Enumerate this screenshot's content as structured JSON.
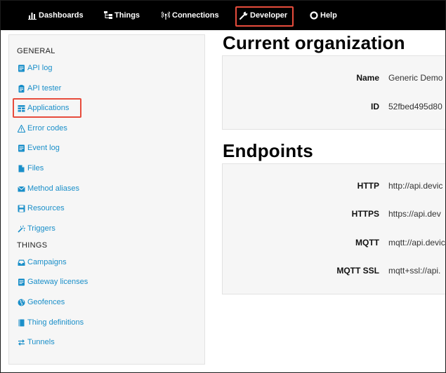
{
  "nav": {
    "items": [
      {
        "label": "Dashboards",
        "icon": "bar-chart-icon"
      },
      {
        "label": "Things",
        "icon": "hierarchy-icon"
      },
      {
        "label": "Connections",
        "icon": "broadcast-icon"
      },
      {
        "label": "Developer",
        "icon": "wrench-icon"
      },
      {
        "label": "Help",
        "icon": "lifebuoy-icon"
      }
    ],
    "highlighted": "Developer",
    "highlight_color": "#e74c3c"
  },
  "sidebar": {
    "general_heading": "GENERAL",
    "general_items": [
      {
        "label": "API log",
        "icon": "log-icon"
      },
      {
        "label": "API tester",
        "icon": "clipboard-icon"
      },
      {
        "label": "Applications",
        "icon": "applications-icon"
      },
      {
        "label": "Error codes",
        "icon": "warning-icon"
      },
      {
        "label": "Event log",
        "icon": "event-log-icon"
      },
      {
        "label": "Files",
        "icon": "file-icon"
      },
      {
        "label": "Method aliases",
        "icon": "envelope-icon"
      },
      {
        "label": "Resources",
        "icon": "save-icon"
      },
      {
        "label": "Triggers",
        "icon": "magic-wand-icon"
      }
    ],
    "things_heading": "THINGS",
    "things_items": [
      {
        "label": "Campaigns",
        "icon": "inbox-icon"
      },
      {
        "label": "Gateway licenses",
        "icon": "license-icon"
      },
      {
        "label": "Geofences",
        "icon": "globe-icon"
      },
      {
        "label": "Thing definitions",
        "icon": "book-icon"
      },
      {
        "label": "Tunnels",
        "icon": "exchange-icon"
      }
    ],
    "highlighted": "Applications",
    "link_color": "#1a8fc9"
  },
  "organization": {
    "title": "Current organization",
    "rows": [
      {
        "label": "Name",
        "value": "Generic Demo"
      },
      {
        "label": "ID",
        "value": "52fbed495d80"
      }
    ]
  },
  "endpoints": {
    "title": "Endpoints",
    "rows": [
      {
        "label": "HTTP",
        "value": "http://api.devic"
      },
      {
        "label": "HTTPS",
        "value": "https://api.dev"
      },
      {
        "label": "MQTT",
        "value": "mqtt://api.devic"
      },
      {
        "label": "MQTT SSL",
        "value": "mqtt+ssl://api."
      }
    ]
  }
}
